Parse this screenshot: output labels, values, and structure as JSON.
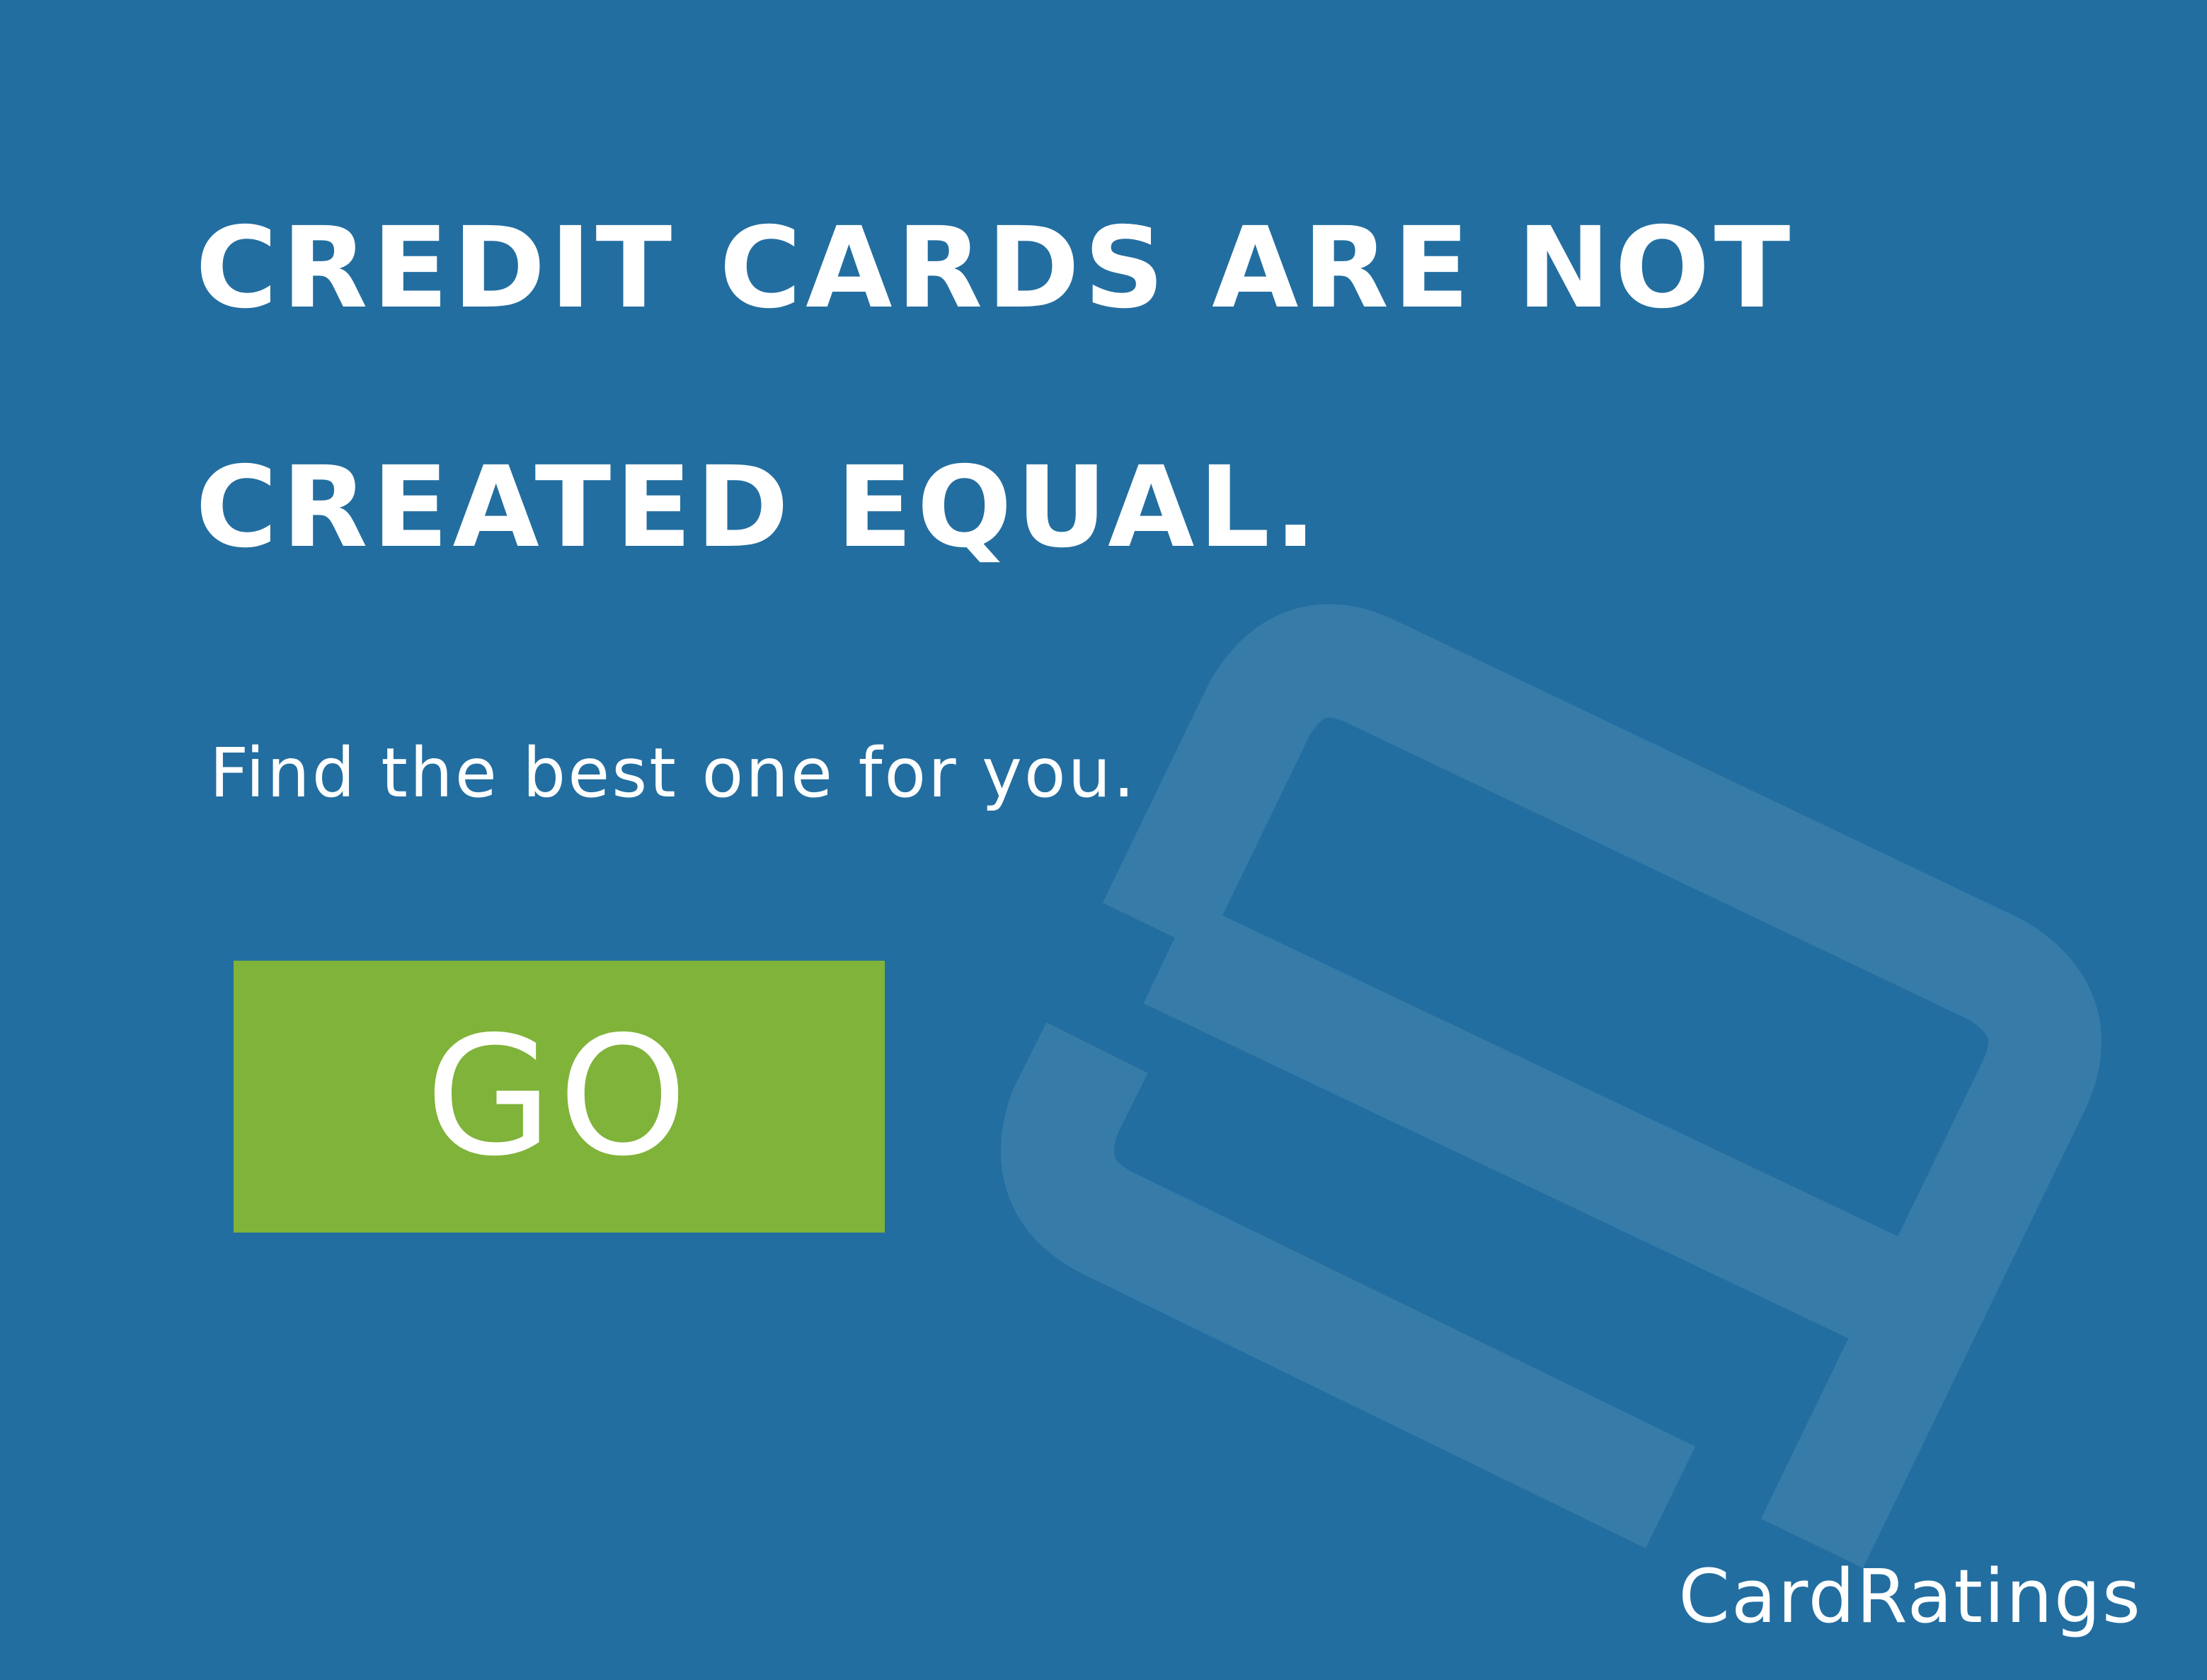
{
  "colors": {
    "background": "#236ea0",
    "logo_mark": "#377ca8",
    "button": "#80b33a",
    "text": "#ffffff"
  },
  "headline": {
    "line_1": "CREDIT CARDS ARE NOT",
    "line_2": "CREATED EQUAL."
  },
  "tagline": "Find the best one for you.",
  "cta": {
    "label": "GO"
  },
  "brand": {
    "name": "CardRatings",
    "icon": "card-ratings-logo-icon"
  }
}
